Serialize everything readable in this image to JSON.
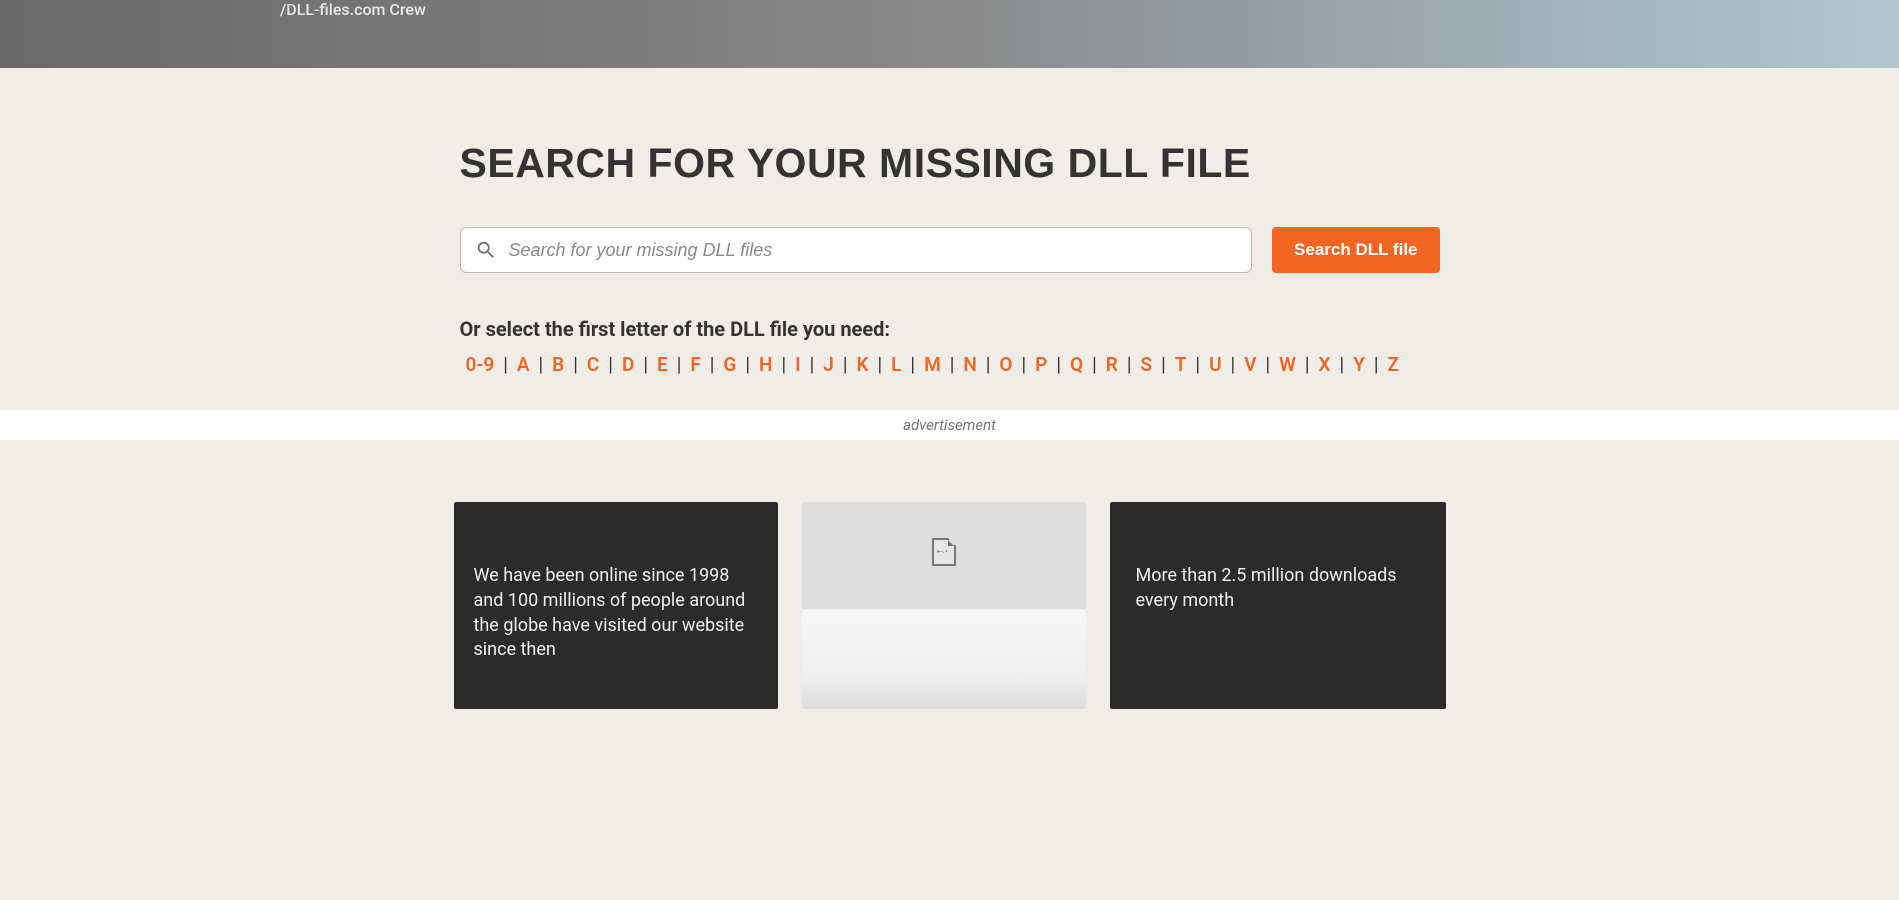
{
  "hero": {
    "sublabel": "/DLL-files.com Crew"
  },
  "search": {
    "heading": "SEARCH FOR YOUR MISSING DLL FILE",
    "placeholder": "Search for your missing DLL files",
    "button_label": "Search DLL file"
  },
  "letter_nav": {
    "prompt": "Or select the first letter of the DLL file you need:",
    "letters": [
      "0-9",
      "A",
      "B",
      "C",
      "D",
      "E",
      "F",
      "G",
      "H",
      "I",
      "J",
      "K",
      "L",
      "M",
      "N",
      "O",
      "P",
      "Q",
      "R",
      "S",
      "T",
      "U",
      "V",
      "W",
      "X",
      "Y",
      "Z"
    ]
  },
  "ad": {
    "label": "advertisement"
  },
  "cards": {
    "card1": "We have been online since 1998 and 100 millions of people around the globe have visited our website since then",
    "card3": "More than 2.5 million downloads every month"
  }
}
